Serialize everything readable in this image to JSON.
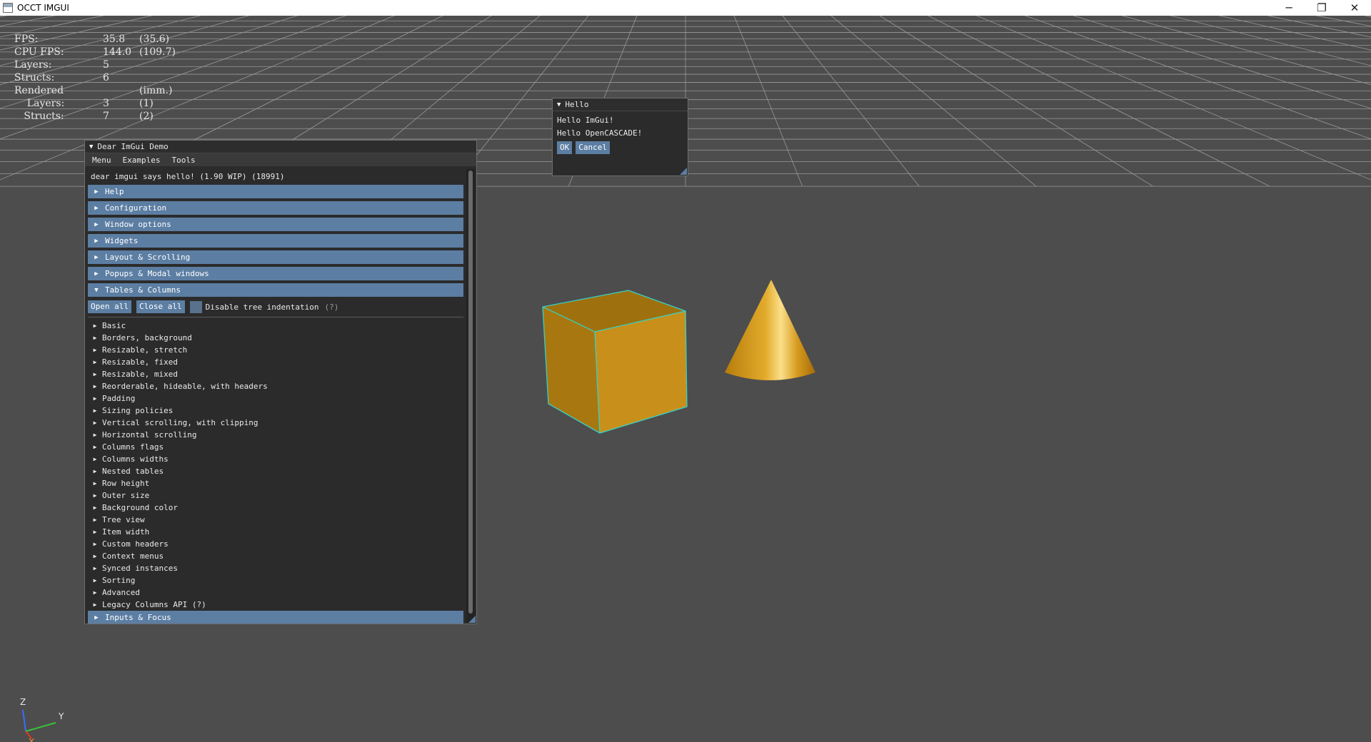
{
  "window": {
    "title": "OCCT IMGUI",
    "minimize_icon": "minimize-icon",
    "restore_icon": "restore-icon",
    "close_icon": "close-icon",
    "minimize_glyph": "─",
    "restore_glyph": "❐",
    "close_glyph": "✕"
  },
  "stats": [
    {
      "key": "FPS:",
      "value": "35.8",
      "paren": "(35.6)"
    },
    {
      "key": "CPU FPS:",
      "value": "144.0",
      "paren": "(109.7)"
    },
    {
      "key": "Layers:",
      "value": "5",
      "paren": ""
    },
    {
      "key": "Structs:",
      "value": "6",
      "paren": ""
    },
    {
      "key": "Rendered",
      "value": "",
      "paren": "(imm.)"
    },
    {
      "key": "    Layers:",
      "value": "3",
      "paren": "(1)"
    },
    {
      "key": "   Structs:",
      "value": "7",
      "paren": "(2)"
    }
  ],
  "demo": {
    "title": "Dear ImGui Demo",
    "menu": [
      "Menu",
      "Examples",
      "Tools"
    ],
    "hello_text": "dear imgui says hello! (1.90 WIP) (18991)",
    "headers_top": [
      "Help",
      "Configuration",
      "Window options",
      "Widgets",
      "Layout & Scrolling",
      "Popups & Modal windows"
    ],
    "open_header": "Tables & Columns",
    "open_all": "Open all",
    "close_all": "Close all",
    "disable_indent": "Disable tree indentation",
    "help_marker": "(?)",
    "items": [
      "Basic",
      "Borders, background",
      "Resizable, stretch",
      "Resizable, fixed",
      "Resizable, mixed",
      "Reorderable, hideable, with headers",
      "Padding",
      "Sizing policies",
      "Vertical scrolling, with clipping",
      "Horizontal scrolling",
      "Columns flags",
      "Columns widths",
      "Nested tables",
      "Row height",
      "Outer size",
      "Background color",
      "Tree view",
      "Item width",
      "Custom headers",
      "Context menus",
      "Synced instances",
      "Sorting",
      "Advanced",
      "Legacy Columns API  (?)"
    ],
    "bottom_header": "Inputs & Focus"
  },
  "hello": {
    "title": "Hello",
    "line1": "Hello ImGui!",
    "line2": "Hello OpenCASCADE!",
    "ok": "OK",
    "cancel": "Cancel"
  },
  "triad": {
    "z": "Z",
    "y": "Y",
    "x": "X"
  },
  "colors": {
    "background": "#4d4d4d",
    "header": "#5c7ea3",
    "shape": "#c8901a",
    "edge_highlight": "#36d1c8"
  }
}
